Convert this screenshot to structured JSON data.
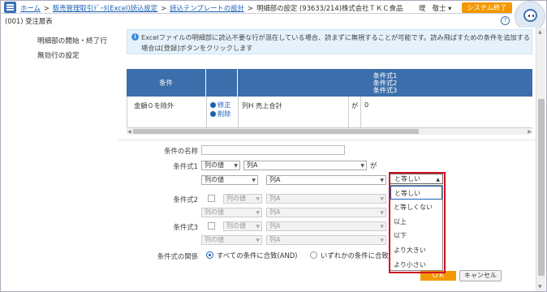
{
  "breadcrumb": {
    "items": [
      "ホーム",
      "販売管理取引ﾃﾞｰﾀ(Excel)読込設定",
      "読込テンプレートの設計"
    ],
    "current": "明細部の設定 (93633/214)株式会社ＴＫＣ食品"
  },
  "header": {
    "user": "堤　敬士 ▾",
    "system_exit": "システム終了",
    "subtitle": "(001) 受注層表",
    "help": "?"
  },
  "sidebar": {
    "items": [
      {
        "label": "明細部の開始・終了行"
      },
      {
        "label": "無効行の設定"
      }
    ]
  },
  "info": {
    "icon": "info-icon",
    "text": "Excelファイルの明細部に読込不要な行が混在している場合、読まずに無視することが可能です。読み飛ばすための条件を追加する場合は[登録]ボタンをクリックします"
  },
  "table": {
    "headers": {
      "condition": "条件",
      "expr1": "条件式1",
      "expr2": "条件式2",
      "expr3": "条件式3"
    },
    "rows": [
      {
        "name": "金額０を除外",
        "edit": "修正",
        "delete": "削除",
        "column": "列H 売上合計",
        "particle": "が",
        "value": "0"
      }
    ]
  },
  "form": {
    "name_label": "条件の名称",
    "name_value": "",
    "expr1": {
      "label": "条件式1",
      "type": "列の値",
      "column": "列A",
      "ga": "が",
      "type2": "列の値",
      "column2": "列A",
      "operator": "と等しい"
    },
    "expr2": {
      "label": "条件式2",
      "type": "列の値",
      "column": "列A",
      "type2": "列の値",
      "column2": "列A"
    },
    "expr3": {
      "label": "条件式3",
      "type": "列の値",
      "column": "列A",
      "type2": "列の値",
      "column2": "列A"
    },
    "relation_label": "条件式の関係",
    "relation_all": "すべての条件に合致(AND)",
    "relation_any": "いずれかの条件に合致"
  },
  "buttons": {
    "ok": "ＯＫ",
    "cancel": "キャンセル"
  },
  "operator_dropdown": {
    "selected": "と等しい",
    "options": [
      "と等しい",
      "と等しくない",
      "以上",
      "以下",
      "より大きい",
      "より小さい"
    ]
  },
  "colors": {
    "accent": "#3b6eaa",
    "orange": "#f39800",
    "highlight": "#d01020"
  }
}
